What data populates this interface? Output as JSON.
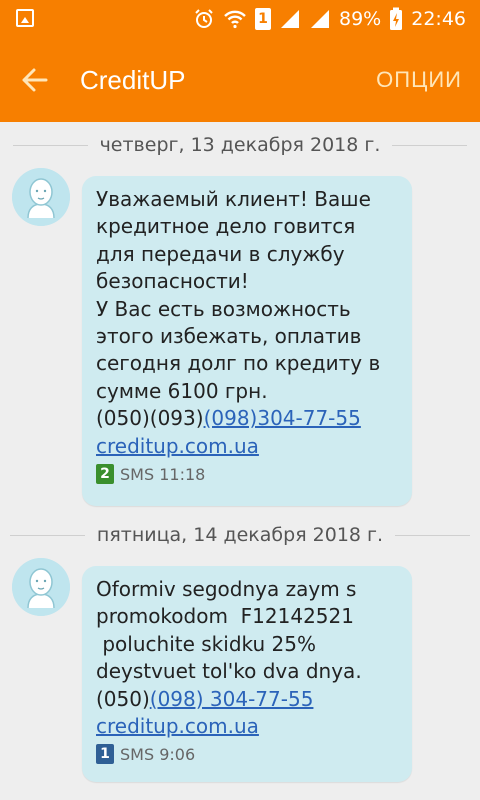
{
  "status_bar": {
    "sim_number": "1",
    "battery": "89%",
    "time": "22:46"
  },
  "app_bar": {
    "title": "CreditUP",
    "menu_label": "ОПЦИИ"
  },
  "colors": {
    "accent": "#f77f00",
    "bubble": "#cfebf0",
    "link": "#2b63b9",
    "sim1": "#2f5f95",
    "sim2": "#3a8f2d"
  },
  "messages": [
    {
      "date": "четверг, 13 декабря 2018 г.",
      "lines": [
        "Уважаемый клиент! Ваше",
        "кредитное дело говится",
        "для передачи в службу",
        "безопасности!",
        "У Вас есть возможность",
        "этого избежать, оплатив",
        "сегодня долг по кредиту в",
        "сумме 6100 грн."
      ],
      "phone_prefix": "(050)(093)",
      "phone_link": "(098)304-77-55",
      "url": "creditup.com.ua",
      "sim": "2",
      "sms_label": "SMS 11:18"
    },
    {
      "date": "пятница, 14 декабря 2018 г.",
      "lines": [
        "Oformiv segodnya zaym s",
        "promokodom  F12142521",
        " poluchite skidku 25%",
        "deystvuet tol'ko dva dnya."
      ],
      "phone_prefix": "(050)",
      "phone_link": "(098) 304-77-55",
      "url": "creditup.com.ua",
      "sim": "1",
      "sms_label": "SMS 9:06"
    }
  ]
}
